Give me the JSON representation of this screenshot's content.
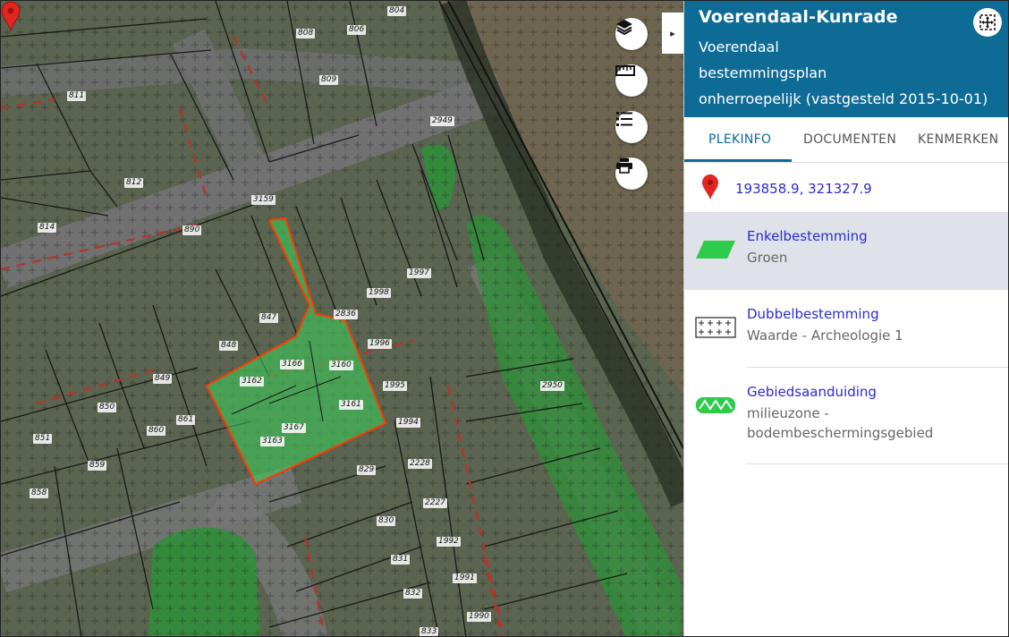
{
  "map": {
    "parcels": [
      "804",
      "808",
      "806",
      "809",
      "811",
      "812",
      "814",
      "890",
      "3159",
      "2949",
      "1997",
      "1998",
      "847",
      "2836",
      "848",
      "1996",
      "3166",
      "3160",
      "849",
      "3162",
      "1995",
      "3161",
      "850",
      "861",
      "1994",
      "3167",
      "860",
      "3163",
      "851",
      "2950",
      "859",
      "829",
      "2228",
      "858",
      "2227",
      "830",
      "1992",
      "831",
      "1991",
      "832",
      "1990",
      "833"
    ],
    "controls": {
      "layers_icon": "layers-icon",
      "measure_icon": "ruler-icon",
      "legend_icon": "list-icon",
      "print_icon": "printer-icon"
    },
    "collapse_glyph": "▸"
  },
  "panel": {
    "title": "Voerendaal-Kunrade",
    "municipality": "Voerendaal",
    "plan_type": "bestemmingsplan",
    "status": "onherroepelijk (vastgesteld 2015-10-01)",
    "tabs": [
      "PLEKINFO",
      "DOCUMENTEN",
      "KENMERKEN"
    ],
    "active_tab": "PLEKINFO",
    "coordinates": "193858.9, 321327.9",
    "items": [
      {
        "title": "Enkelbestemming",
        "subtitle": "Groen",
        "icon": "green-parallelogram-icon",
        "color": "#2ecc4a"
      },
      {
        "title": "Dubbelbestemming",
        "subtitle": "Waarde - Archeologie 1",
        "icon": "cross-hatch-icon"
      },
      {
        "title": "Gebiedsaanduiding",
        "subtitle": "milieuzone - bodembeschermingsgebied",
        "icon": "green-zigzag-icon",
        "color": "#2ecc4a"
      }
    ]
  },
  "colors": {
    "header": "#0e6b96",
    "link": "#2a2ad8",
    "selection": "#ff3b00",
    "green_zone": "#2ecc4a"
  }
}
